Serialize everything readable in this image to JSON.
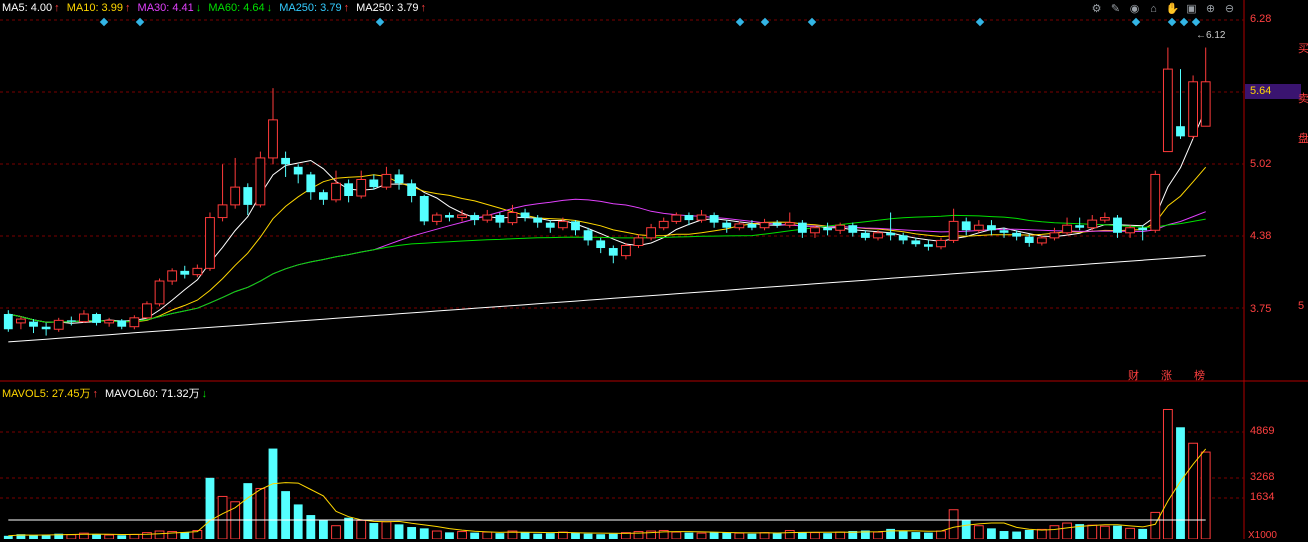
{
  "ma_legend": [
    {
      "label": "MA5: 4.00",
      "arrow": "↑",
      "color": "#ffffff"
    },
    {
      "label": "MA10: 3.99",
      "arrow": "↑",
      "color": "#ffd700"
    },
    {
      "label": "MA30: 4.41",
      "arrow": "↓",
      "color": "#e040fb"
    },
    {
      "label": "MA60: 4.64",
      "arrow": "↓",
      "color": "#00e000"
    },
    {
      "label": "MA250: 3.79",
      "arrow": "↑",
      "color": "#33ccff"
    },
    {
      "label": "MA250: 3.79",
      "arrow": "↑",
      "color": "#ffffff"
    }
  ],
  "vol_legend": [
    {
      "label": "MAVOL5: 27.45万",
      "arrow": "↑",
      "color": "#ffd700"
    },
    {
      "label": "MAVOL60: 71.32万",
      "arrow": "↓",
      "color": "#ffffff"
    }
  ],
  "price_axis": [
    "6.28",
    "5.64",
    "5.02",
    "4.38",
    "3.75"
  ],
  "current_price": "5.64",
  "high_label": "6.12",
  "vol_axis": [
    "4869",
    "3268",
    "1634"
  ],
  "vol_unit": "X1000",
  "tags": [
    "财",
    "涨",
    "榜"
  ],
  "toolbar": [
    "gear-icon",
    "pen-icon",
    "eye-icon",
    "house-icon",
    "hand-icon",
    "full-icon",
    "zoom-in-icon",
    "zoom-out-icon"
  ],
  "edge_text": [
    "买",
    "卖",
    "盘",
    "5"
  ],
  "chart_data": {
    "type": "candlestick",
    "price_range": [
      3.5,
      6.4
    ],
    "volume_max": 5000,
    "candles": [
      [
        3.9,
        4.02,
        4.05,
        3.88,
        "d"
      ],
      [
        3.95,
        3.98,
        4.0,
        3.9,
        "u"
      ],
      [
        3.96,
        3.92,
        3.98,
        3.87,
        "d"
      ],
      [
        3.92,
        3.9,
        3.95,
        3.85,
        "d"
      ],
      [
        3.9,
        3.97,
        3.99,
        3.88,
        "u"
      ],
      [
        3.97,
        3.96,
        4.0,
        3.93,
        "d"
      ],
      [
        3.96,
        4.02,
        4.05,
        3.95,
        "u"
      ],
      [
        4.02,
        3.95,
        4.03,
        3.93,
        "d"
      ],
      [
        3.95,
        3.97,
        3.99,
        3.92,
        "u"
      ],
      [
        3.97,
        3.92,
        3.98,
        3.9,
        "d"
      ],
      [
        3.92,
        3.99,
        4.01,
        3.9,
        "u"
      ],
      [
        3.99,
        4.1,
        4.12,
        3.98,
        "u"
      ],
      [
        4.1,
        4.28,
        4.3,
        4.08,
        "u"
      ],
      [
        4.28,
        4.36,
        4.38,
        4.25,
        "u"
      ],
      [
        4.36,
        4.33,
        4.4,
        4.3,
        "d"
      ],
      [
        4.33,
        4.38,
        4.41,
        4.31,
        "u"
      ],
      [
        4.38,
        4.78,
        4.82,
        4.36,
        "u"
      ],
      [
        4.78,
        4.88,
        5.2,
        4.75,
        "u"
      ],
      [
        4.88,
        5.02,
        5.25,
        4.85,
        "u"
      ],
      [
        5.02,
        4.88,
        5.05,
        4.8,
        "d"
      ],
      [
        4.88,
        5.25,
        5.3,
        4.86,
        "u"
      ],
      [
        5.25,
        5.55,
        5.8,
        5.2,
        "u"
      ],
      [
        5.2,
        5.25,
        5.3,
        5.1,
        "d"
      ],
      [
        5.18,
        5.12,
        5.2,
        5.05,
        "d"
      ],
      [
        5.12,
        4.98,
        5.14,
        4.92,
        "d"
      ],
      [
        4.98,
        4.92,
        5.0,
        4.88,
        "d"
      ],
      [
        4.92,
        5.05,
        5.15,
        4.9,
        "u"
      ],
      [
        5.05,
        4.95,
        5.08,
        4.9,
        "d"
      ],
      [
        4.95,
        5.08,
        5.15,
        4.93,
        "u"
      ],
      [
        5.08,
        5.02,
        5.12,
        5.0,
        "d"
      ],
      [
        5.02,
        5.12,
        5.18,
        5.0,
        "u"
      ],
      [
        5.12,
        5.05,
        5.16,
        5.0,
        "d"
      ],
      [
        5.05,
        4.95,
        5.08,
        4.9,
        "d"
      ],
      [
        4.95,
        4.75,
        4.96,
        4.72,
        "d"
      ],
      [
        4.75,
        4.8,
        4.82,
        4.72,
        "u"
      ],
      [
        4.8,
        4.78,
        4.82,
        4.75,
        "d"
      ],
      [
        4.78,
        4.8,
        4.84,
        4.75,
        "u"
      ],
      [
        4.8,
        4.76,
        4.82,
        4.72,
        "d"
      ],
      [
        4.76,
        4.8,
        4.84,
        4.74,
        "u"
      ],
      [
        4.8,
        4.74,
        4.82,
        4.7,
        "d"
      ],
      [
        4.74,
        4.82,
        4.88,
        4.72,
        "u"
      ],
      [
        4.82,
        4.78,
        4.85,
        4.75,
        "d"
      ],
      [
        4.78,
        4.74,
        4.8,
        4.7,
        "d"
      ],
      [
        4.74,
        4.7,
        4.76,
        4.66,
        "d"
      ],
      [
        4.7,
        4.75,
        4.78,
        4.68,
        "u"
      ],
      [
        4.75,
        4.68,
        4.76,
        4.64,
        "d"
      ],
      [
        4.68,
        4.6,
        4.7,
        4.56,
        "d"
      ],
      [
        4.6,
        4.54,
        4.62,
        4.5,
        "d"
      ],
      [
        4.54,
        4.48,
        4.56,
        4.42,
        "d"
      ],
      [
        4.48,
        4.56,
        4.58,
        4.45,
        "u"
      ],
      [
        4.56,
        4.62,
        4.65,
        4.54,
        "u"
      ],
      [
        4.62,
        4.7,
        4.73,
        4.6,
        "u"
      ],
      [
        4.7,
        4.75,
        4.78,
        4.68,
        "u"
      ],
      [
        4.75,
        4.8,
        4.82,
        4.73,
        "u"
      ],
      [
        4.8,
        4.76,
        4.82,
        4.72,
        "d"
      ],
      [
        4.76,
        4.8,
        4.84,
        4.74,
        "u"
      ],
      [
        4.8,
        4.74,
        4.82,
        4.7,
        "d"
      ],
      [
        4.74,
        4.7,
        4.76,
        4.66,
        "d"
      ],
      [
        4.7,
        4.73,
        4.75,
        4.68,
        "u"
      ],
      [
        4.73,
        4.7,
        4.76,
        4.68,
        "d"
      ],
      [
        4.7,
        4.74,
        4.77,
        4.68,
        "u"
      ],
      [
        4.74,
        4.72,
        4.76,
        4.7,
        "d"
      ],
      [
        4.72,
        4.74,
        4.82,
        4.7,
        "u"
      ],
      [
        4.74,
        4.66,
        4.76,
        4.62,
        "d"
      ],
      [
        4.66,
        4.7,
        4.72,
        4.62,
        "u"
      ],
      [
        4.7,
        4.68,
        4.74,
        4.64,
        "d"
      ],
      [
        4.68,
        4.72,
        4.74,
        4.65,
        "u"
      ],
      [
        4.72,
        4.66,
        4.74,
        4.63,
        "d"
      ],
      [
        4.66,
        4.62,
        4.68,
        4.6,
        "d"
      ],
      [
        4.62,
        4.66,
        4.68,
        4.6,
        "u"
      ],
      [
        4.66,
        4.64,
        4.82,
        4.6,
        "d"
      ],
      [
        4.64,
        4.6,
        4.66,
        4.57,
        "d"
      ],
      [
        4.6,
        4.57,
        4.62,
        4.55,
        "d"
      ],
      [
        4.57,
        4.55,
        4.6,
        4.52,
        "d"
      ],
      [
        4.55,
        4.6,
        4.62,
        4.53,
        "u"
      ],
      [
        4.6,
        4.75,
        4.85,
        4.58,
        "u"
      ],
      [
        4.75,
        4.68,
        4.78,
        4.64,
        "d"
      ],
      [
        4.68,
        4.72,
        4.76,
        4.66,
        "u"
      ],
      [
        4.72,
        4.68,
        4.76,
        4.64,
        "d"
      ],
      [
        4.68,
        4.66,
        4.7,
        4.62,
        "d"
      ],
      [
        4.66,
        4.63,
        4.68,
        4.6,
        "d"
      ],
      [
        4.63,
        4.58,
        4.65,
        4.55,
        "d"
      ],
      [
        4.58,
        4.62,
        4.64,
        4.56,
        "u"
      ],
      [
        4.62,
        4.66,
        4.7,
        4.6,
        "u"
      ],
      [
        4.66,
        4.72,
        4.78,
        4.64,
        "u"
      ],
      [
        4.72,
        4.7,
        4.78,
        4.68,
        "d"
      ],
      [
        4.7,
        4.76,
        4.8,
        4.68,
        "u"
      ],
      [
        4.76,
        4.78,
        4.82,
        4.74,
        "u"
      ],
      [
        4.78,
        4.66,
        4.8,
        4.62,
        "d"
      ],
      [
        4.66,
        4.7,
        4.72,
        4.62,
        "u"
      ],
      [
        4.7,
        4.68,
        4.72,
        4.6,
        "d"
      ],
      [
        4.68,
        5.12,
        5.15,
        4.66,
        "u"
      ],
      [
        5.3,
        5.95,
        6.12,
        5.3,
        "u"
      ],
      [
        5.5,
        5.42,
        5.95,
        5.4,
        "d"
      ],
      [
        5.42,
        5.85,
        5.9,
        5.4,
        "u"
      ],
      [
        5.5,
        5.85,
        6.12,
        5.5,
        "u"
      ]
    ],
    "volumes": [
      [
        120,
        "d"
      ],
      [
        180,
        "d"
      ],
      [
        140,
        "d"
      ],
      [
        160,
        "d"
      ],
      [
        200,
        "d"
      ],
      [
        160,
        "u"
      ],
      [
        220,
        "u"
      ],
      [
        180,
        "d"
      ],
      [
        150,
        "u"
      ],
      [
        140,
        "d"
      ],
      [
        170,
        "u"
      ],
      [
        240,
        "u"
      ],
      [
        300,
        "u"
      ],
      [
        280,
        "u"
      ],
      [
        260,
        "d"
      ],
      [
        320,
        "u"
      ],
      [
        2300,
        "d"
      ],
      [
        1600,
        "u"
      ],
      [
        1400,
        "u"
      ],
      [
        2100,
        "d"
      ],
      [
        1900,
        "u"
      ],
      [
        3400,
        "d"
      ],
      [
        1800,
        "d"
      ],
      [
        1300,
        "d"
      ],
      [
        900,
        "d"
      ],
      [
        700,
        "d"
      ],
      [
        500,
        "u"
      ],
      [
        800,
        "d"
      ],
      [
        700,
        "u"
      ],
      [
        600,
        "d"
      ],
      [
        650,
        "u"
      ],
      [
        550,
        "d"
      ],
      [
        450,
        "d"
      ],
      [
        400,
        "d"
      ],
      [
        300,
        "u"
      ],
      [
        250,
        "d"
      ],
      [
        280,
        "u"
      ],
      [
        240,
        "d"
      ],
      [
        260,
        "u"
      ],
      [
        220,
        "d"
      ],
      [
        300,
        "u"
      ],
      [
        260,
        "d"
      ],
      [
        200,
        "d"
      ],
      [
        220,
        "d"
      ],
      [
        260,
        "u"
      ],
      [
        240,
        "d"
      ],
      [
        200,
        "d"
      ],
      [
        180,
        "d"
      ],
      [
        200,
        "d"
      ],
      [
        240,
        "u"
      ],
      [
        280,
        "u"
      ],
      [
        300,
        "u"
      ],
      [
        320,
        "u"
      ],
      [
        260,
        "u"
      ],
      [
        240,
        "d"
      ],
      [
        220,
        "u"
      ],
      [
        260,
        "d"
      ],
      [
        240,
        "d"
      ],
      [
        220,
        "u"
      ],
      [
        200,
        "d"
      ],
      [
        240,
        "u"
      ],
      [
        220,
        "d"
      ],
      [
        320,
        "u"
      ],
      [
        260,
        "d"
      ],
      [
        240,
        "u"
      ],
      [
        220,
        "d"
      ],
      [
        260,
        "u"
      ],
      [
        300,
        "d"
      ],
      [
        320,
        "d"
      ],
      [
        260,
        "u"
      ],
      [
        380,
        "d"
      ],
      [
        300,
        "d"
      ],
      [
        260,
        "d"
      ],
      [
        240,
        "d"
      ],
      [
        300,
        "u"
      ],
      [
        1100,
        "u"
      ],
      [
        700,
        "d"
      ],
      [
        500,
        "u"
      ],
      [
        400,
        "d"
      ],
      [
        300,
        "d"
      ],
      [
        280,
        "d"
      ],
      [
        340,
        "d"
      ],
      [
        360,
        "u"
      ],
      [
        500,
        "u"
      ],
      [
        600,
        "u"
      ],
      [
        560,
        "d"
      ],
      [
        520,
        "u"
      ],
      [
        480,
        "u"
      ],
      [
        500,
        "d"
      ],
      [
        400,
        "u"
      ],
      [
        380,
        "d"
      ],
      [
        1000,
        "u"
      ],
      [
        4869,
        "u"
      ],
      [
        4200,
        "d"
      ],
      [
        3600,
        "u"
      ],
      [
        3268,
        "u"
      ]
    ]
  }
}
